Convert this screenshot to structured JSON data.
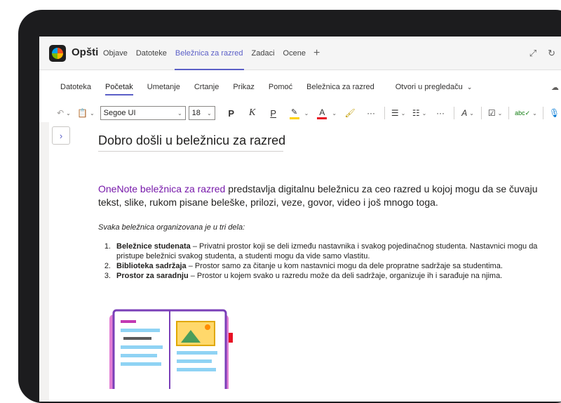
{
  "header": {
    "channel": "Opšti",
    "tabs": [
      {
        "label": "Objave",
        "active": false
      },
      {
        "label": "Datoteke",
        "active": false
      },
      {
        "label": "Beležnica za razred",
        "active": true
      },
      {
        "label": "Zadaci",
        "active": false
      },
      {
        "label": "Ocene",
        "active": false
      }
    ],
    "add_tab_icon": "plus-icon",
    "expand_icon": "expand-icon",
    "refresh_icon": "refresh-icon"
  },
  "ribbon": {
    "tabs": [
      {
        "label": "Datoteka",
        "active": false
      },
      {
        "label": "Početak",
        "active": true
      },
      {
        "label": "Umetanje",
        "active": false
      },
      {
        "label": "Crtanje",
        "active": false
      },
      {
        "label": "Prikaz",
        "active": false
      },
      {
        "label": "Pomoć",
        "active": false
      },
      {
        "label": "Beležnica za razred",
        "active": false
      },
      {
        "label": "Otvori u pregledaču",
        "active": false
      }
    ],
    "font_name": "Segoe UI",
    "font_size": "18",
    "bold_label": "P",
    "italic_label": "K",
    "underline_label": "P",
    "more_label": "···",
    "highlight_color": "#ffd200",
    "font_color": "#e81123"
  },
  "page": {
    "title": "Dobro došli u beležnicu za razred",
    "intro_link": "OneNote beležnica za razred",
    "intro_rest": " predstavlja digitalnu beležnicu za ceo razred u kojoj mogu da se čuvaju tekst, slike, rukom pisane beleške, prilozi, veze, govor, video i još mnogo toga.",
    "subhead": "Svaka beležnica organizovana je u tri dela:",
    "steps": [
      {
        "num": "1.",
        "bold": "Beležnice studenata",
        "text": " – Privatni prostor koji se deli između nastavnika i svakog pojedinačnog studenta. Nastavnici mogu da pristupe beležnici svakog studenta, a studenti mogu da vide samo vlastitu."
      },
      {
        "num": "2.",
        "bold": "Biblioteka sadržaja",
        "text": " – Prostor samo za čitanje u kom nastavnici mogu da dele propratne sadržaje sa studentima."
      },
      {
        "num": "3.",
        "bold": "Prostor za saradnju",
        "text": " – Prostor u kojem svako u razredu može da deli sadržaje, organizuje ih i sarađuje na njima."
      }
    ]
  },
  "colors": {
    "accent": "#5b5fc7",
    "link": "#7719aa"
  }
}
